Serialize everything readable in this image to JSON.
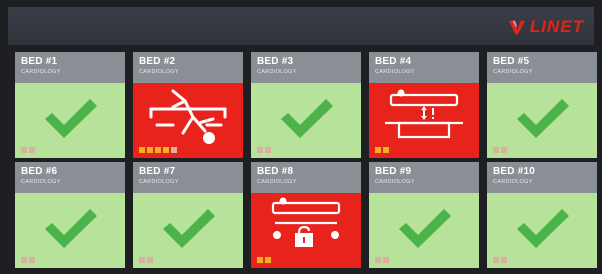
{
  "brand": {
    "logo_text": "LINET"
  },
  "colors": {
    "ok": "#b7e29a",
    "alert": "#e8231c",
    "header": "#8a8f96",
    "indicator_on": "#f3b21c",
    "indicator_off": "#dcb0a0"
  },
  "beds": [
    {
      "title": "BED #1",
      "dept": "CARDIOLOGY",
      "status": "ok",
      "icon": "check-icon",
      "indicators": [
        "off",
        "off"
      ]
    },
    {
      "title": "BED #2",
      "dept": "CARDIOLOGY",
      "status": "alert",
      "icon": "patient-fall-icon",
      "indicators": [
        "on",
        "on",
        "on",
        "on",
        "off"
      ]
    },
    {
      "title": "BED #3",
      "dept": "CARDIOLOGY",
      "status": "ok",
      "icon": "check-icon",
      "indicators": [
        "off",
        "off"
      ]
    },
    {
      "title": "BED #4",
      "dept": "CARDIOLOGY",
      "status": "alert",
      "icon": "bed-height-warning-icon",
      "indicators": [
        "on",
        "on"
      ]
    },
    {
      "title": "BED #5",
      "dept": "CARDIOLOGY",
      "status": "ok",
      "icon": "check-icon",
      "indicators": [
        "off",
        "off"
      ]
    },
    {
      "title": "BED #6",
      "dept": "CARDIOLOGY",
      "status": "ok",
      "icon": "check-icon",
      "indicators": [
        "off",
        "off"
      ]
    },
    {
      "title": "BED #7",
      "dept": "CARDIOLOGY",
      "status": "ok",
      "icon": "check-icon",
      "indicators": [
        "off",
        "off"
      ]
    },
    {
      "title": "BED #8",
      "dept": "CARDIOLOGY",
      "status": "alert",
      "icon": "brake-unlocked-icon",
      "indicators": [
        "on",
        "on"
      ]
    },
    {
      "title": "BED #9",
      "dept": "CARDIOLOGY",
      "status": "ok",
      "icon": "check-icon",
      "indicators": [
        "off",
        "off"
      ]
    },
    {
      "title": "BED #10",
      "dept": "CARDIOLOGY",
      "status": "ok",
      "icon": "check-icon",
      "indicators": [
        "off",
        "off"
      ]
    }
  ]
}
